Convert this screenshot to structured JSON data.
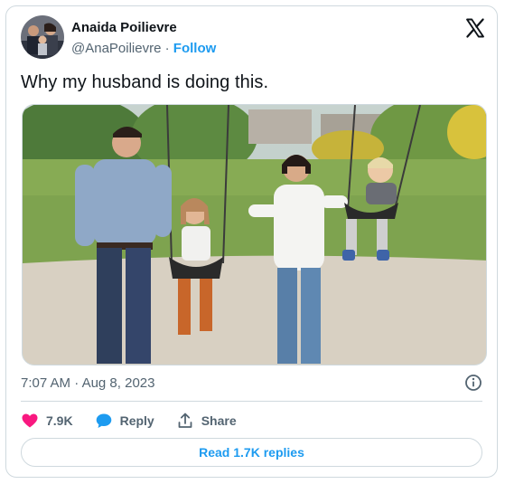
{
  "author": {
    "name": "Anaida Poilievre",
    "handle": "@AnaPoilievre",
    "separator": "·",
    "follow_label": "Follow"
  },
  "tweet": {
    "text": "Why my husband is doing this.",
    "time": "7:07 AM",
    "separator": "·",
    "date": "Aug 8, 2023"
  },
  "media": {
    "description": "Video frame: a family pushing two children on swings in a park"
  },
  "actions": {
    "likes": "7.9K",
    "reply_label": "Reply",
    "share_label": "Share"
  },
  "replies_button": "Read 1.7K replies",
  "colors": {
    "accent": "#1d9bf0",
    "like": "#f91880",
    "text": "#0f1419",
    "secondary": "#536471",
    "border": "#cfd9de"
  },
  "icons": {
    "brand": "x-logo-icon",
    "info": "info-icon",
    "like": "heart-icon",
    "reply": "speech-bubble-icon",
    "share": "share-upload-icon"
  }
}
